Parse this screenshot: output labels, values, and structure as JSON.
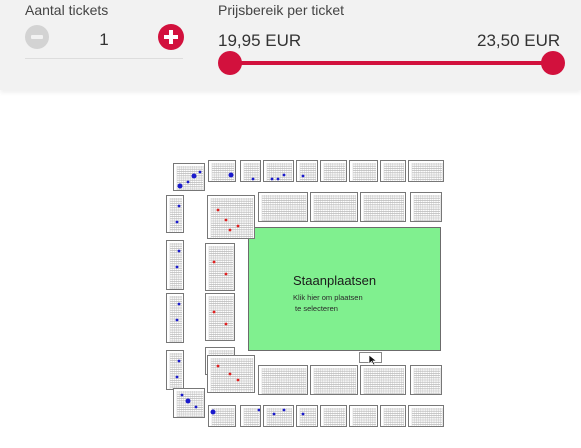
{
  "tickets": {
    "label": "Aantal tickets",
    "count": "1"
  },
  "price_range": {
    "label": "Prijsbereik per ticket",
    "min": "19,95 EUR",
    "max": "23,50 EUR"
  },
  "standing_area": {
    "title": "Staanplaatsen",
    "line1": "Klik hier om plaatsen",
    "line2": "te selecteren"
  },
  "colors": {
    "accent": "#d2113d",
    "field": "#80f08f",
    "seat_taken": "#1a1acc",
    "seat_available": "#e02020"
  },
  "icons": [
    "minus-icon",
    "plus-icon",
    "cursor-icon"
  ]
}
